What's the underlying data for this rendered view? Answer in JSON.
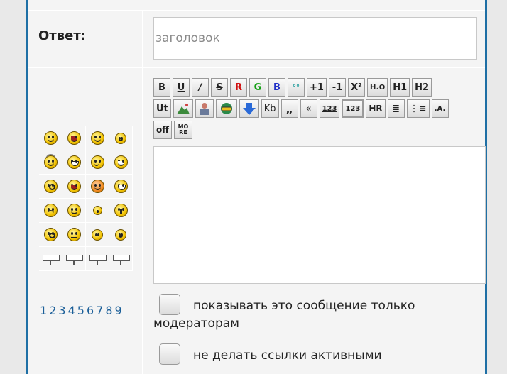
{
  "form": {
    "answer_label": "Ответ:",
    "subject_placeholder": "заголовок",
    "subject_value": ""
  },
  "toolbar": {
    "row1": [
      "B",
      "U",
      "/",
      "S",
      "R",
      "G",
      "B",
      "°°",
      "+1",
      "-1",
      "X²",
      "H₂O",
      "H1",
      "H2"
    ],
    "row2": [
      "Ut",
      "mountain-image-icon",
      "person-icon",
      "link-globe-icon",
      "down-arrow-icon",
      "Kb",
      "„",
      "«",
      "123",
      "123",
      "HR",
      "≣",
      "⋮≡",
      ".A."
    ],
    "row3": [
      "off",
      "MORE"
    ]
  },
  "smileys": {
    "rows": [
      [
        "smile-icon",
        "laughing-icon",
        "grin-icon",
        "thumbs-up-icon"
      ],
      [
        "angel-icon",
        "teeth-icon",
        "smirk-icon",
        "big-grin-icon"
      ],
      [
        "surprised-icon",
        "blush-icon",
        "in-love-icon",
        "wide-grin-icon"
      ],
      [
        "sad-icon",
        "wink-icon",
        "kiss-icon",
        "shocked-icon"
      ],
      [
        "confused-icon",
        "neutral-icon",
        "plain-icon",
        "reading-icon"
      ],
      [
        "sign-icon",
        "sign-icon",
        "sign-icon",
        "sign-icon"
      ]
    ],
    "pages": [
      "1",
      "2",
      "3",
      "4",
      "5",
      "6",
      "7",
      "8",
      "9"
    ]
  },
  "options": {
    "moderators_only_label": "показывать это сообщение только модераторам",
    "no_active_links_label": "не делать ссылки активными"
  },
  "colors": {
    "frame_border": "#1e6fa5",
    "link": "#1a5e98"
  }
}
